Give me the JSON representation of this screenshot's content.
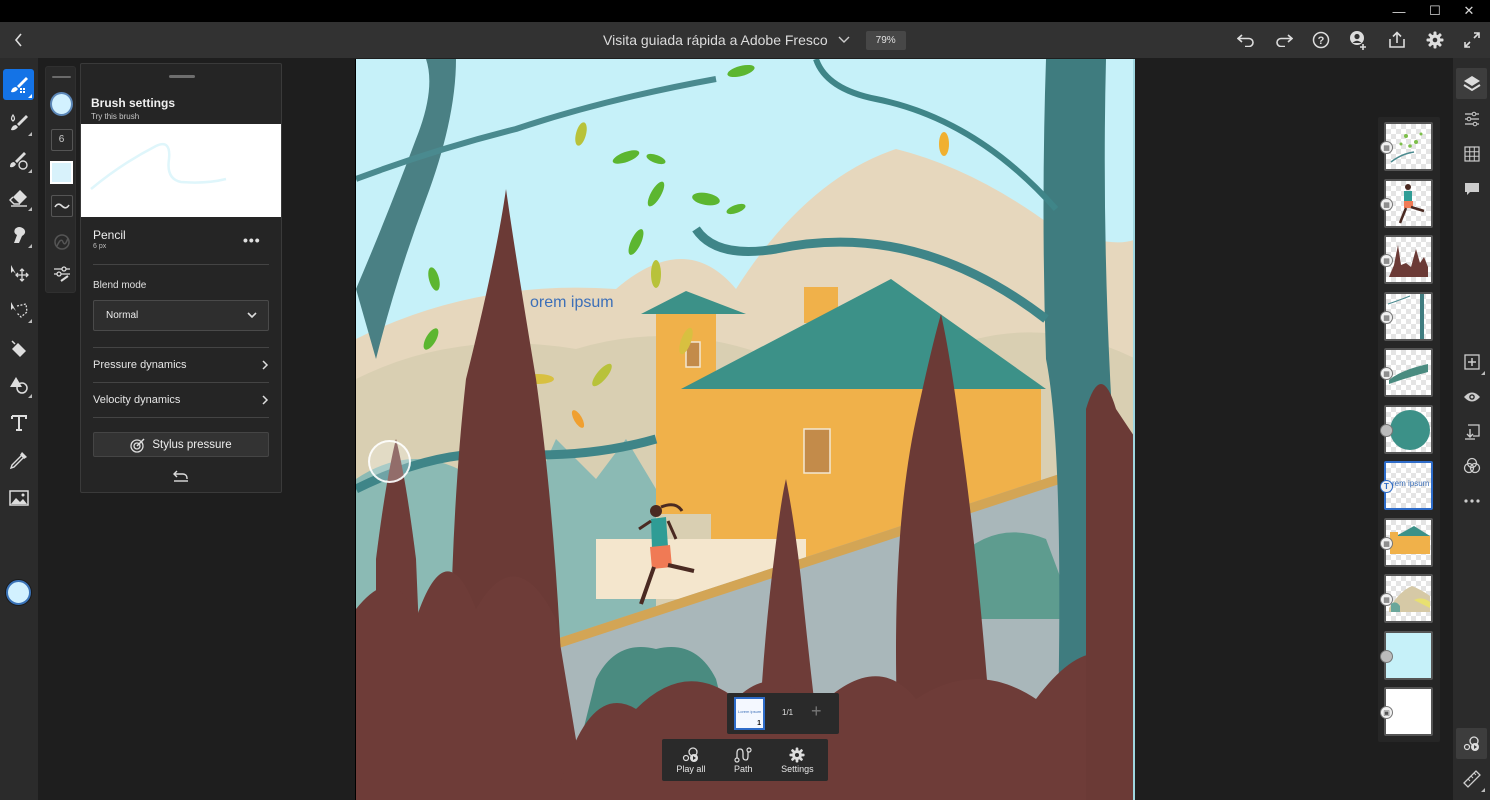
{
  "window": {
    "minimize_icon": "minimize-icon",
    "maximize_icon": "maximize-icon",
    "close_icon": "close-icon",
    "minimize": "—",
    "maximize": "☐",
    "close": "✕"
  },
  "header": {
    "back_icon": "chevron-left-icon",
    "title": "Visita guiada rápida a Adobe Fresco",
    "zoom": "79%",
    "actions": [
      "undo",
      "redo",
      "help",
      "invite",
      "share",
      "settings",
      "fullscreen"
    ]
  },
  "tools": {
    "items": [
      "pixel-brush",
      "live-brush",
      "vector-brush",
      "eraser",
      "smudge",
      "transform",
      "selection",
      "fill",
      "shapes",
      "type",
      "eyedropper",
      "place-image"
    ],
    "active": "pixel-brush",
    "color": "#d2f1ff"
  },
  "brush_subtools": {
    "size": "6"
  },
  "brush_panel": {
    "title": "Brush settings",
    "subtitle": "Try this brush",
    "brush_name": "Pencil",
    "brush_size": "6 px",
    "more": "•••",
    "blend_label": "Blend mode",
    "blend_value": "Normal",
    "pressure": "Pressure dynamics",
    "velocity": "Velocity dynamics",
    "stylus": "Stylus pressure"
  },
  "canvas": {
    "text_layer": "orem ipsum"
  },
  "frames": {
    "thumb_text": "Lorem ipsum",
    "thumb_num": "1",
    "count": "1/1",
    "add": "+"
  },
  "animation": {
    "play_all": "Play all",
    "path": "Path",
    "settings": "Settings"
  },
  "right_rail": {
    "items": [
      "layers",
      "layer-properties",
      "grid",
      "comments",
      "add-layer",
      "visibility",
      "merge-down",
      "blend",
      "more",
      "motion",
      "ruler"
    ]
  },
  "layers": [
    {
      "name": "leaves",
      "type": "pixel"
    },
    {
      "name": "runner",
      "type": "pixel"
    },
    {
      "name": "trees-dark",
      "type": "pixel"
    },
    {
      "name": "branches",
      "type": "pixel"
    },
    {
      "name": "bush",
      "type": "pixel"
    },
    {
      "name": "circle",
      "type": "vector"
    },
    {
      "name": "lorem ipsum",
      "type": "text",
      "selected": true
    },
    {
      "name": "house",
      "type": "pixel"
    },
    {
      "name": "mountains",
      "type": "pixel"
    },
    {
      "name": "sky",
      "type": "vector"
    },
    {
      "name": "background",
      "type": "image"
    }
  ]
}
